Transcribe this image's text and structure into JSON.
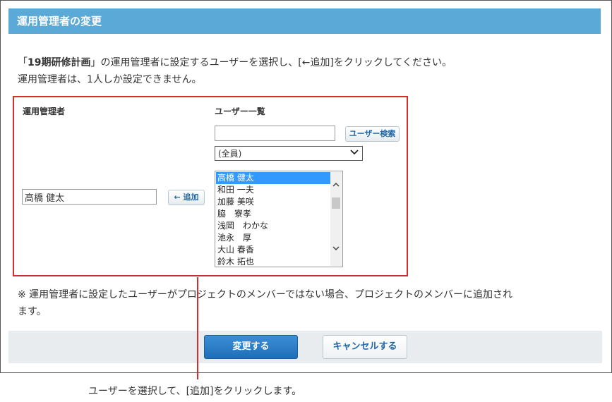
{
  "dialog": {
    "title": "運用管理者の変更",
    "desc_line1_prefix": "「",
    "desc_line1_bold": "19期研修計画",
    "desc_line1_suffix": "」の運用管理者に設定するユーザーを選択し、[←追加]をクリックしてください。",
    "desc_line2": "運用管理者は、1人しか設定できません。"
  },
  "admin": {
    "label": "運用管理者",
    "value": "高橋 健太",
    "add_button": "← 追加"
  },
  "user_list": {
    "label": "ユーザー一覧",
    "search_value": "",
    "search_button": "ユーザー検索",
    "group_select": "(全員)",
    "selected_index": 0,
    "items": [
      "高橋 健太",
      "和田 一夫",
      "加藤 美咲",
      "脇　寮孝",
      "浅岡　わかな",
      "池永　厚",
      "大山 春香",
      "鈴木 拓也"
    ]
  },
  "note": {
    "line1": "※ 運用管理者に設定したユーザーがプロジェクトのメンバーではない場合、プロジェクトのメンバーに追加され",
    "line2": "ます。"
  },
  "footer": {
    "change_button": "変更する",
    "cancel_button": "キャンセルする"
  },
  "annotation": {
    "caption": "ユーザーを選択して、[追加]をクリックします。"
  }
}
